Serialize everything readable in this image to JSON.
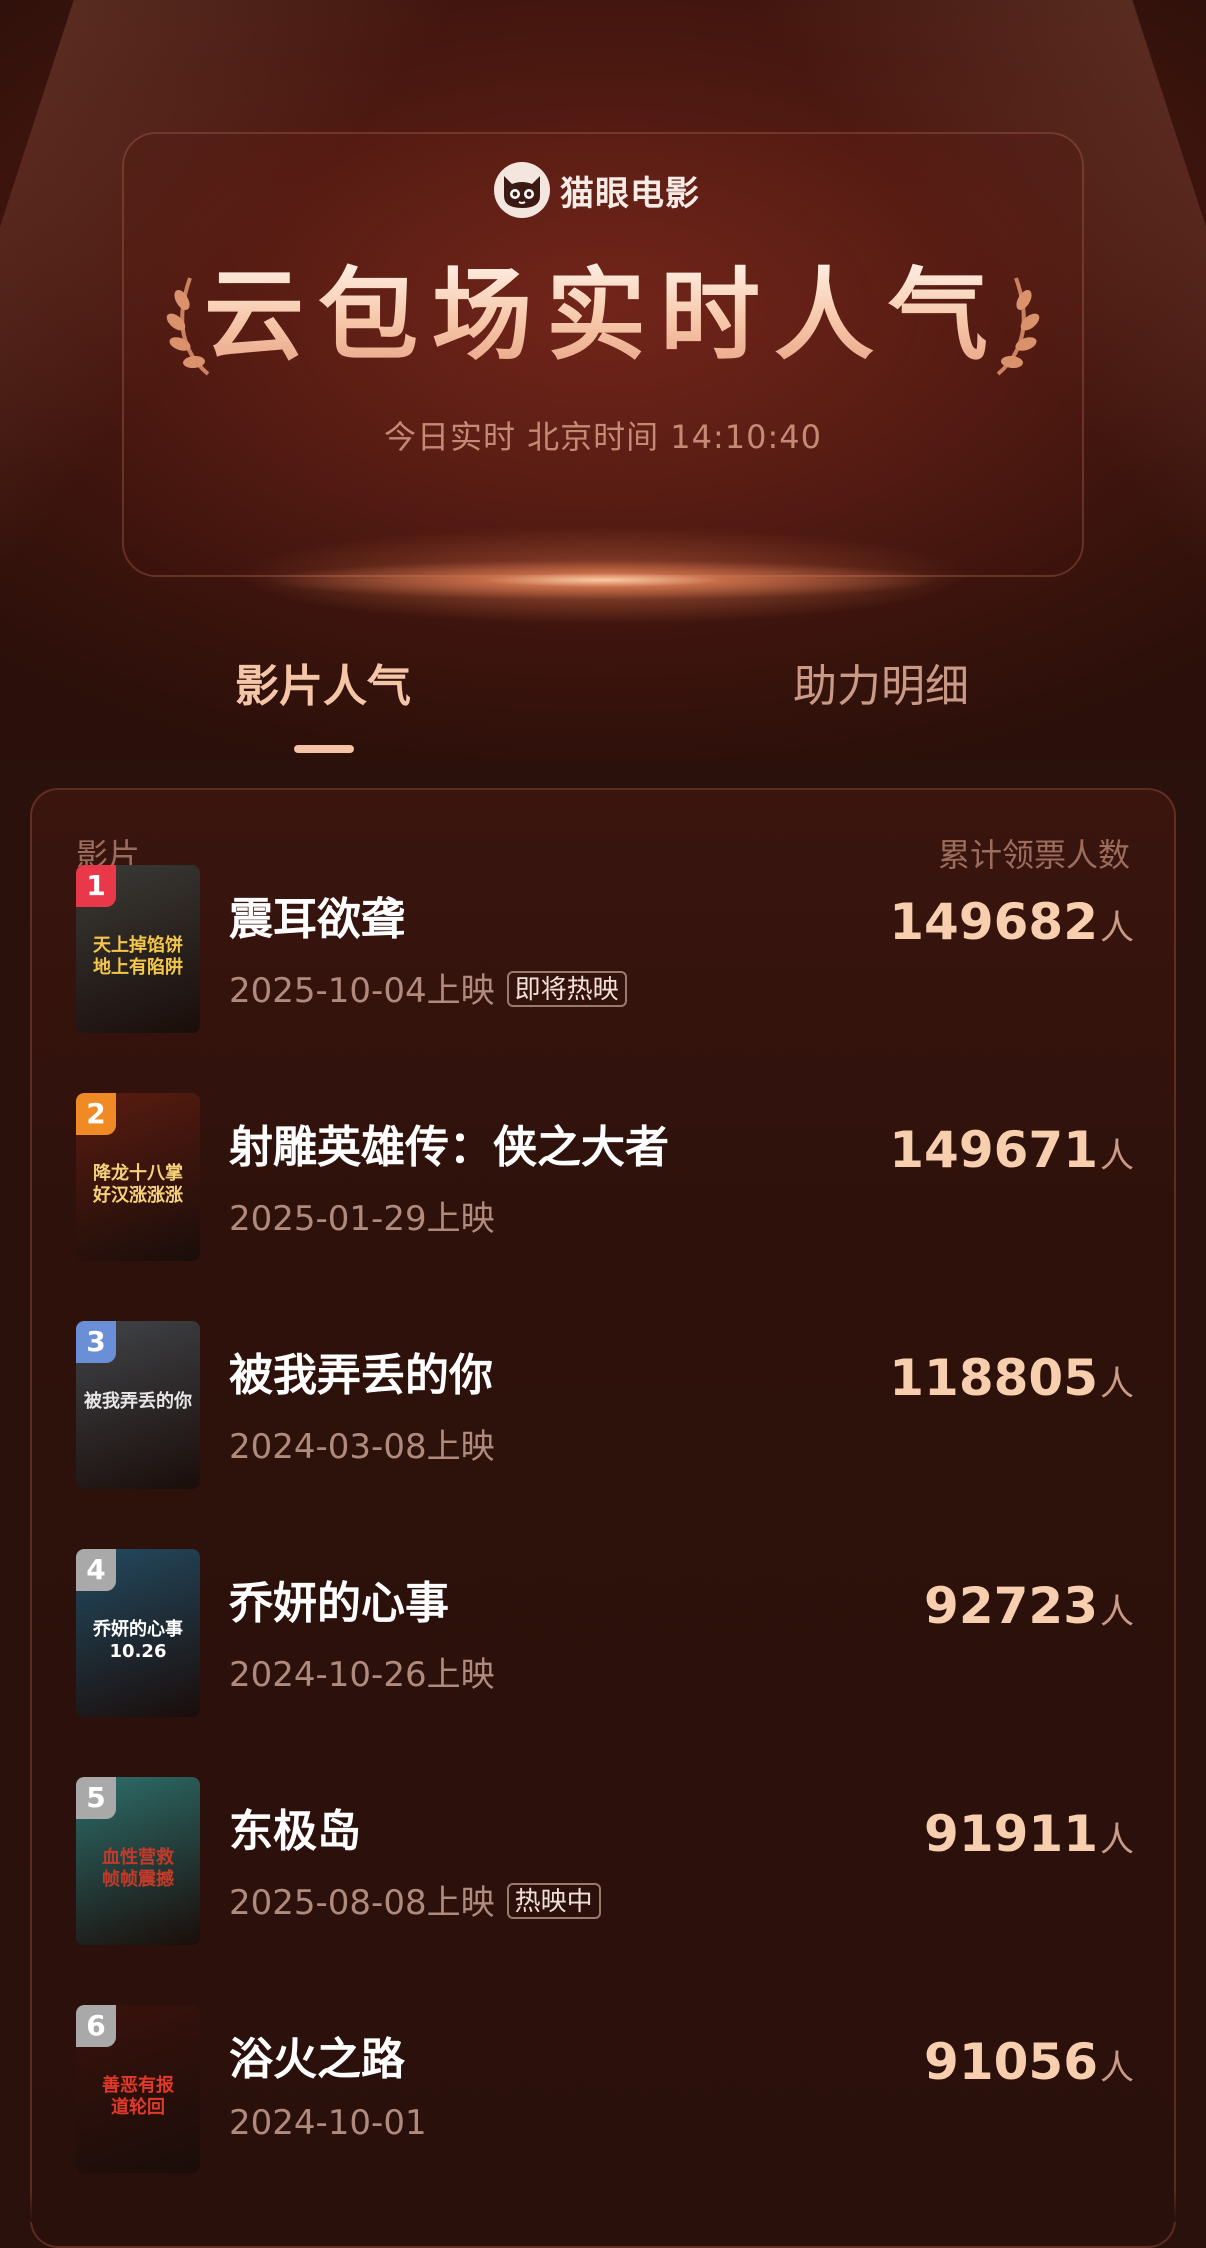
{
  "app": {
    "logo_text": "猫眼电影",
    "logo_icon": "cat-face-icon"
  },
  "hero": {
    "title": "云包场实时人气",
    "subtitle": "今日实时  北京时间  14:10:40"
  },
  "tabs": [
    {
      "label": "影片人气",
      "active": true
    },
    {
      "label": "助力明细",
      "active": false
    }
  ],
  "table": {
    "col_film": "影片",
    "col_count": "累计领票人数",
    "unit": "人",
    "rows": [
      {
        "rank": "1",
        "title": "震耳欲聋",
        "date": "2025-10-04上映",
        "badge": "即将热映",
        "count": "149682",
        "poster_text": "天上掉馅饼\n地上有陷阱",
        "poster_bg": "#3a3a36",
        "poster_fg": "#f4c74a",
        "rank_color": "#e8384a"
      },
      {
        "rank": "2",
        "title": "射雕英雄传：侠之大者",
        "date": "2025-01-29上映",
        "badge": "",
        "count": "149671",
        "poster_text": "降龙十八掌\n好汉涨涨涨",
        "poster_bg": "#5a1c10",
        "poster_fg": "#f5d27a",
        "rank_color": "#f08a24"
      },
      {
        "rank": "3",
        "title": "被我弄丢的你",
        "date": "2024-03-08上映",
        "badge": "",
        "count": "118805",
        "poster_text": "被我弄丢的你",
        "poster_bg": "#404448",
        "poster_fg": "#e7e7e7",
        "rank_color": "#6b8fd6"
      },
      {
        "rank": "4",
        "title": "乔妍的心事",
        "date": "2024-10-26上映",
        "badge": "",
        "count": "92723",
        "poster_text": "乔妍的心事\n10.26",
        "poster_bg": "#234a60",
        "poster_fg": "#ffffff",
        "rank_color": "#a9a9a9"
      },
      {
        "rank": "5",
        "title": "东极岛",
        "date": "2025-08-08上映",
        "badge": "热映中",
        "count": "91911",
        "poster_text": "血性营救\n帧帧震撼",
        "poster_bg": "#2d6e6a",
        "poster_fg": "#c23a2a",
        "rank_color": "#a9a9a9"
      },
      {
        "rank": "6",
        "title": "浴火之路",
        "date": "2024-10-01",
        "badge": "",
        "count": "91056",
        "poster_text": "善恶有报\n道轮回",
        "poster_bg": "#3a120c",
        "poster_fg": "#e23a2a",
        "rank_color": "#a9a9a9"
      }
    ]
  },
  "colors": {
    "background": "#2a110c",
    "accent": "#f7cfae",
    "muted": "#b08a7c"
  }
}
